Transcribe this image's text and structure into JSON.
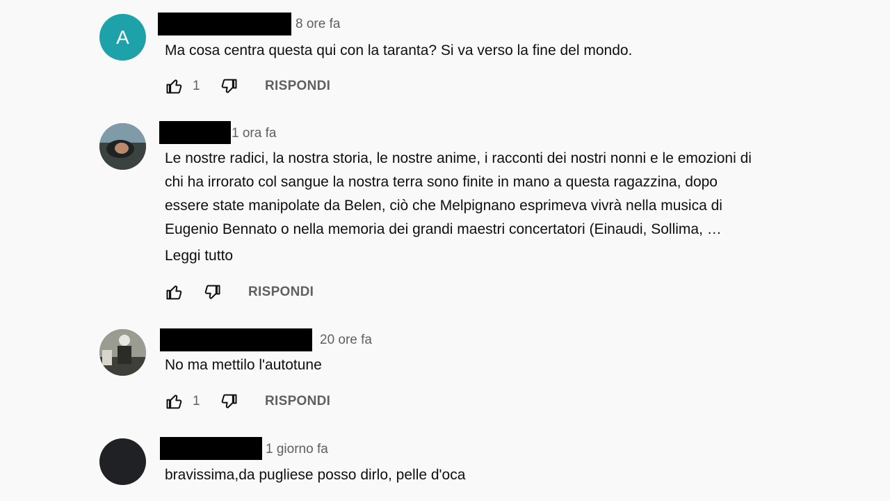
{
  "comments": [
    {
      "avatar_letter": "A",
      "time": "8 ore fa",
      "lines": [
        "Ma cosa centra questa qui con la taranta? Si va verso la fine del mondo."
      ],
      "likes": "1",
      "reply_label": "RISPONDI"
    },
    {
      "time": "1 ora fa",
      "lines": [
        "Le nostre radici, la nostra storia, le nostre anime, i racconti dei nostri nonni e le emozioni di",
        "chi ha irrorato col sangue la nostra  terra sono finite in mano a questa ragazzina, dopo",
        "essere state manipolate da Belen, ciò che Melpignano esprimeva vivrà nella musica di",
        "Eugenio Bennato o nella memoria dei grandi maestri concertatori (Einaudi, Sollima, …"
      ],
      "read_more": "Leggi tutto",
      "reply_label": "RISPONDI"
    },
    {
      "time": "20 ore fa",
      "lines": [
        "No ma mettilo l'autotune"
      ],
      "likes": "1",
      "reply_label": "RISPONDI"
    },
    {
      "time": "1 giorno fa",
      "lines": [
        "bravissima,da pugliese posso dirlo, pelle d'oca"
      ]
    }
  ],
  "colors": {
    "background": "#f9f9f9",
    "avatar_teal": "#1ea2a9",
    "meta_gray": "#606060",
    "redaction": "#000000"
  },
  "icons": [
    "thumb-up-icon",
    "thumb-down-icon"
  ]
}
